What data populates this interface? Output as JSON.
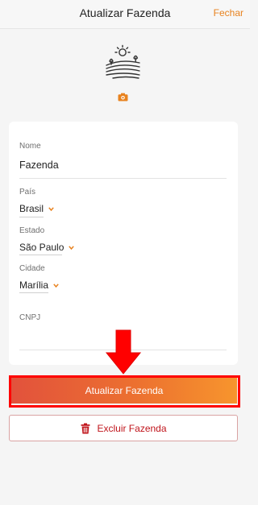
{
  "header": {
    "title": "Atualizar Fazenda",
    "close_label": "Fechar"
  },
  "form": {
    "nome": {
      "label": "Nome",
      "value": "Fazenda"
    },
    "pais": {
      "label": "País",
      "value": "Brasil"
    },
    "estado": {
      "label": "Estado",
      "value": "São Paulo"
    },
    "cidade": {
      "label": "Cidade",
      "value": "Marília"
    },
    "cnpj": {
      "label": "CNPJ",
      "value": ""
    }
  },
  "actions": {
    "update_label": "Atualizar Fazenda",
    "delete_label": "Excluir Fazenda"
  },
  "icons": {
    "farm": "farm-landscape-icon",
    "camera": "camera-icon",
    "trash": "trash-icon",
    "chevron": "chevron-down-icon",
    "annotation_arrow": "down-arrow-icon"
  },
  "colors": {
    "accent": "#e8821e",
    "button_gradient_start": "#e2523c",
    "button_gradient_end": "#f7952d",
    "danger": "#c0141b",
    "highlight": "#ff0000"
  }
}
